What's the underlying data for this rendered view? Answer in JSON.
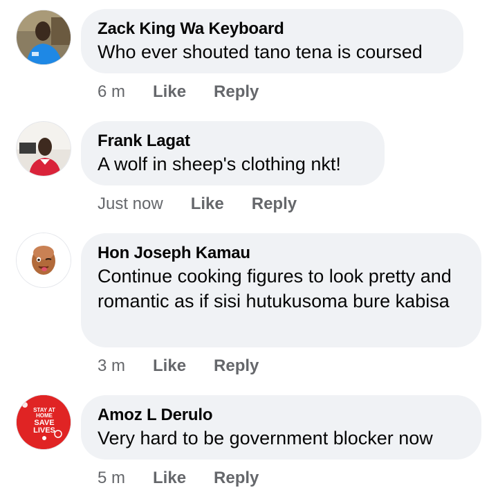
{
  "comments": [
    {
      "author": "Zack King Wa Keyboard",
      "text": "Who ever shouted tano tena is coursed",
      "time": "6 m",
      "like": "Like",
      "reply": "Reply",
      "avatar": "profile-photo-man-blue-shirt"
    },
    {
      "author": "Frank Lagat",
      "text": "A wolf in sheep's clothing nkt!",
      "time": "Just now",
      "like": "Like",
      "reply": "Reply",
      "avatar": "profile-photo-man-red-shirt"
    },
    {
      "author": "Hon Joseph Kamau",
      "text": "Continue cooking figures to look pretty and romantic as if sisi hutukusoma bure kabisa",
      "time": "3 m",
      "like": "Like",
      "reply": "Reply",
      "avatar": "memoji-winking-face"
    },
    {
      "author": "Amoz L Derulo",
      "text": "Very hard to be government blocker now",
      "time": "5 m",
      "like": "Like",
      "reply": "Reply",
      "avatar": "stay-at-home-badge",
      "avatar_lines": [
        "STAY AT",
        "HOME",
        "SAVE",
        "LIVES"
      ]
    }
  ],
  "colors": {
    "bubble": "#f0f2f5",
    "name": "#050505",
    "meta": "#65676b",
    "badge_red": "#e02424"
  }
}
